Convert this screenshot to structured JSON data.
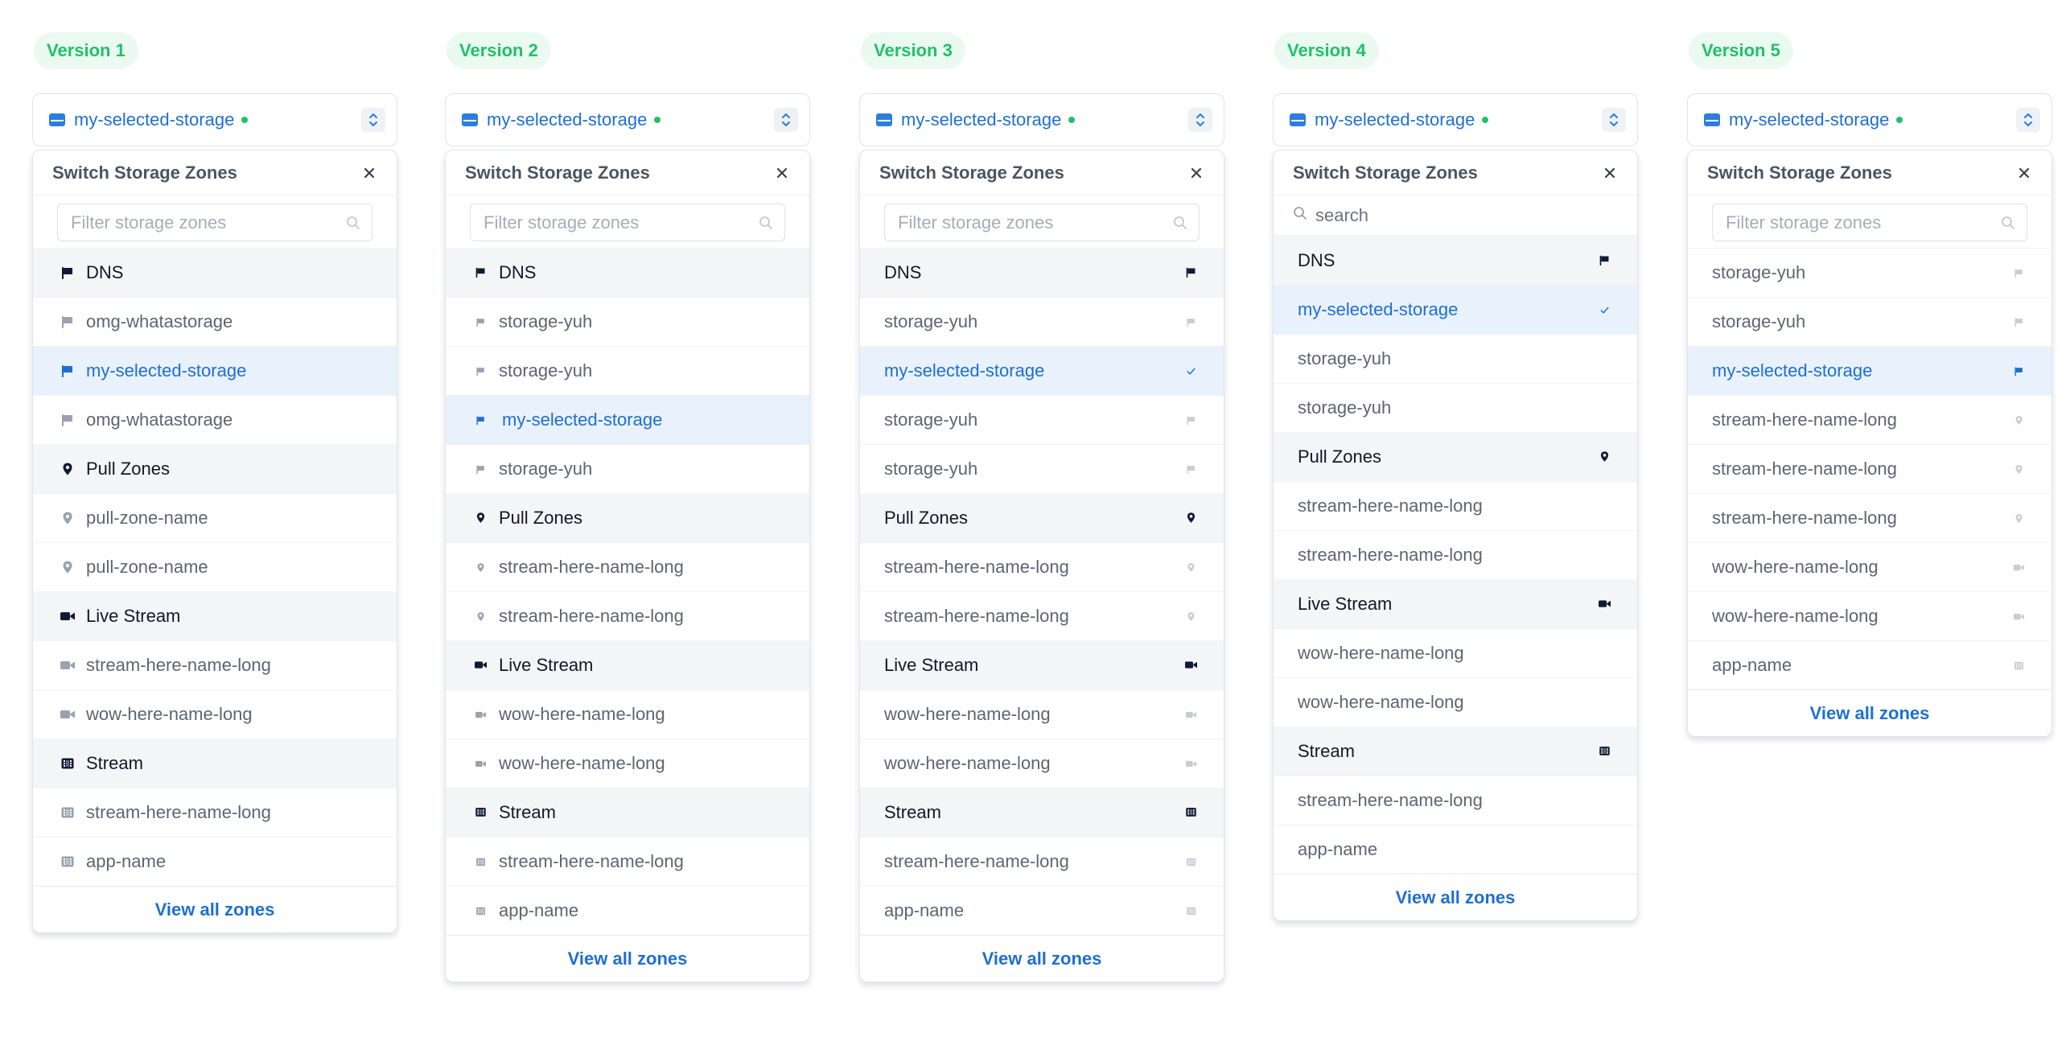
{
  "versions": [
    {
      "badge": "Version 1",
      "trigger_label": "my-selected-storage",
      "panel_title": "Switch Storage Zones",
      "search_placeholder": "Filter storage zones",
      "footer_label": "View all zones",
      "rows": [
        {
          "label": "DNS",
          "kind": "header",
          "icon": "flag-icon"
        },
        {
          "label": "omg-whatastorage",
          "kind": "item",
          "icon": "flag-icon"
        },
        {
          "label": "my-selected-storage",
          "kind": "selected",
          "icon": "flag-icon"
        },
        {
          "label": "omg-whatastorage",
          "kind": "item",
          "icon": "flag-icon"
        },
        {
          "label": "Pull Zones",
          "kind": "header",
          "icon": "map-pin-icon"
        },
        {
          "label": "pull-zone-name",
          "kind": "item",
          "icon": "map-pin-icon"
        },
        {
          "label": "pull-zone-name",
          "kind": "item",
          "icon": "map-pin-icon"
        },
        {
          "label": "Live Stream",
          "kind": "header",
          "icon": "video-camera-icon"
        },
        {
          "label": "stream-here-name-long",
          "kind": "item",
          "icon": "video-camera-icon"
        },
        {
          "label": "wow-here-name-long",
          "kind": "item",
          "icon": "video-camera-icon"
        },
        {
          "label": "Stream",
          "kind": "header",
          "icon": "film-icon"
        },
        {
          "label": "stream-here-name-long",
          "kind": "item",
          "icon": "film-icon"
        },
        {
          "label": "app-name",
          "kind": "item",
          "icon": "film-icon"
        }
      ]
    },
    {
      "badge": "Version 2",
      "trigger_label": "my-selected-storage",
      "panel_title": "Switch Storage Zones",
      "search_placeholder": "Filter storage zones",
      "footer_label": "View all zones",
      "rows": [
        {
          "label": "DNS",
          "kind": "header",
          "icon": "flag-icon"
        },
        {
          "label": "storage-yuh",
          "kind": "item",
          "icon": "flag-icon"
        },
        {
          "label": "storage-yuh",
          "kind": "item",
          "icon": "flag-icon"
        },
        {
          "label": "my-selected-storage",
          "kind": "selected",
          "icon": "flag-icon"
        },
        {
          "label": "storage-yuh",
          "kind": "item",
          "icon": "flag-icon"
        },
        {
          "label": "Pull Zones",
          "kind": "header",
          "icon": "map-pin-icon"
        },
        {
          "label": "stream-here-name-long",
          "kind": "item",
          "icon": "map-pin-icon"
        },
        {
          "label": "stream-here-name-long",
          "kind": "item",
          "icon": "map-pin-icon"
        },
        {
          "label": "Live Stream",
          "kind": "header",
          "icon": "video-camera-icon"
        },
        {
          "label": "wow-here-name-long",
          "kind": "item",
          "icon": "video-camera-icon"
        },
        {
          "label": "wow-here-name-long",
          "kind": "item",
          "icon": "video-camera-icon"
        },
        {
          "label": "Stream",
          "kind": "header",
          "icon": "film-icon"
        },
        {
          "label": "stream-here-name-long",
          "kind": "item",
          "icon": "film-icon"
        },
        {
          "label": "app-name",
          "kind": "item",
          "icon": "film-icon"
        }
      ]
    },
    {
      "badge": "Version 3",
      "trigger_label": "my-selected-storage",
      "panel_title": "Switch Storage Zones",
      "search_placeholder": "Filter storage zones",
      "footer_label": "View all zones",
      "rows": [
        {
          "label": "DNS",
          "kind": "header",
          "icon": "flag-icon"
        },
        {
          "label": "storage-yuh",
          "kind": "item",
          "icon": "flag-icon"
        },
        {
          "label": "my-selected-storage",
          "kind": "selected",
          "icon": "check-icon"
        },
        {
          "label": "storage-yuh",
          "kind": "item",
          "icon": "flag-icon"
        },
        {
          "label": "storage-yuh",
          "kind": "item",
          "icon": "flag-icon"
        },
        {
          "label": "Pull Zones",
          "kind": "header",
          "icon": "map-pin-icon"
        },
        {
          "label": "stream-here-name-long",
          "kind": "item",
          "icon": "map-pin-icon"
        },
        {
          "label": "stream-here-name-long",
          "kind": "item",
          "icon": "map-pin-icon"
        },
        {
          "label": "Live Stream",
          "kind": "header",
          "icon": "video-camera-icon"
        },
        {
          "label": "wow-here-name-long",
          "kind": "item",
          "icon": "video-camera-icon"
        },
        {
          "label": "wow-here-name-long",
          "kind": "item",
          "icon": "video-camera-icon"
        },
        {
          "label": "Stream",
          "kind": "header",
          "icon": "film-icon"
        },
        {
          "label": "stream-here-name-long",
          "kind": "item",
          "icon": "film-icon"
        },
        {
          "label": "app-name",
          "kind": "item",
          "icon": "film-icon"
        }
      ]
    },
    {
      "badge": "Version 4",
      "trigger_label": "my-selected-storage",
      "panel_title": "Switch Storage Zones",
      "search_placeholder": "search",
      "footer_label": "View all zones",
      "rows": [
        {
          "label": "DNS",
          "kind": "header",
          "icon": "flag-icon"
        },
        {
          "label": "my-selected-storage",
          "kind": "selected",
          "icon": "check-icon"
        },
        {
          "label": "storage-yuh",
          "kind": "item",
          "icon": ""
        },
        {
          "label": "storage-yuh",
          "kind": "item",
          "icon": ""
        },
        {
          "label": "Pull Zones",
          "kind": "header",
          "icon": "map-pin-icon"
        },
        {
          "label": "stream-here-name-long",
          "kind": "item",
          "icon": ""
        },
        {
          "label": "stream-here-name-long",
          "kind": "item",
          "icon": ""
        },
        {
          "label": "Live Stream",
          "kind": "header",
          "icon": "video-camera-icon"
        },
        {
          "label": "wow-here-name-long",
          "kind": "item",
          "icon": ""
        },
        {
          "label": "wow-here-name-long",
          "kind": "item",
          "icon": ""
        },
        {
          "label": "Stream",
          "kind": "header",
          "icon": "film-icon"
        },
        {
          "label": "stream-here-name-long",
          "kind": "item",
          "icon": ""
        },
        {
          "label": "app-name",
          "kind": "item",
          "icon": ""
        }
      ]
    },
    {
      "badge": "Version 5",
      "trigger_label": "my-selected-storage",
      "panel_title": "Switch Storage Zones",
      "search_placeholder": "Filter storage zones",
      "footer_label": "View all zones",
      "rows": [
        {
          "label": "storage-yuh",
          "kind": "item",
          "icon": "flag-icon"
        },
        {
          "label": "storage-yuh",
          "kind": "item",
          "icon": "flag-icon"
        },
        {
          "label": "my-selected-storage",
          "kind": "selected",
          "icon": "flag-icon"
        },
        {
          "label": "stream-here-name-long",
          "kind": "item",
          "icon": "map-pin-icon"
        },
        {
          "label": "stream-here-name-long",
          "kind": "item",
          "icon": "map-pin-icon"
        },
        {
          "label": "stream-here-name-long",
          "kind": "item",
          "icon": "map-pin-icon"
        },
        {
          "label": "wow-here-name-long",
          "kind": "item",
          "icon": "video-camera-icon"
        },
        {
          "label": "wow-here-name-long",
          "kind": "item",
          "icon": "video-camera-icon"
        },
        {
          "label": "app-name",
          "kind": "item",
          "icon": "film-icon"
        }
      ]
    }
  ],
  "colors": {
    "accent": "#1f6fd0",
    "badge_text": "#22c06a",
    "badge_bg": "#ebfaf1",
    "selected_bg": "#e8f1fc",
    "header_bg": "#f4f5f7",
    "online": "#22c06a"
  }
}
